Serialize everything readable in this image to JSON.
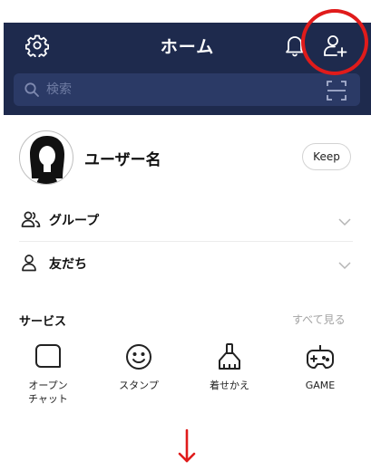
{
  "header": {
    "title": "ホーム",
    "background": "#1e2a4d",
    "icons": {
      "settings": "gear-icon",
      "notifications": "bell-icon",
      "add_friend": "add-friend-icon"
    }
  },
  "search": {
    "placeholder": "検索",
    "icon": "search-icon",
    "scan_icon": "qr-scan-icon"
  },
  "profile": {
    "username": "ユーザー名",
    "keep_label": "Keep"
  },
  "list": {
    "items": [
      {
        "label": "グループ",
        "icon": "group-icon"
      },
      {
        "label": "友だち",
        "icon": "friend-icon"
      }
    ]
  },
  "services": {
    "title": "サービス",
    "see_all": "すべて見る",
    "items": [
      {
        "label": "オープン\nチャット",
        "icon": "open-chat-icon"
      },
      {
        "label": "スタンプ",
        "icon": "sticker-icon"
      },
      {
        "label": "着せかえ",
        "icon": "theme-brush-icon"
      },
      {
        "label": "GAME",
        "icon": "game-controller-icon"
      }
    ]
  },
  "annotations": {
    "highlight_color": "#e01b1b"
  }
}
